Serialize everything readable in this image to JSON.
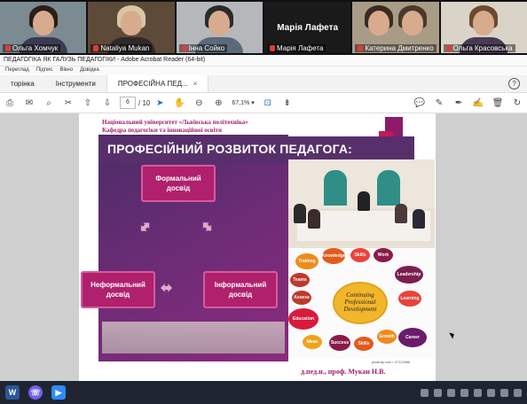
{
  "participants": [
    {
      "name": "Ольга Хомчук",
      "muted": true
    },
    {
      "name": "Nataliya Mukan",
      "muted": true
    },
    {
      "name": "Інна Сойко",
      "muted": true
    },
    {
      "name": "Марія Лафета",
      "muted": true,
      "display_text": "Марія Лафета"
    },
    {
      "name": "Катерина Дмитренко",
      "muted": true
    },
    {
      "name": "Ольга Красовська",
      "muted": true
    }
  ],
  "acrobat": {
    "window_title": "ПЕДАГОГІКА ЯК ГАЛУЗЬ ПЕДАГОГІКИ - Adobe Acrobat Reader (64-bit)",
    "menu": [
      "Переглад",
      "Підпис",
      "Вікно",
      "Довідка"
    ],
    "tabs": {
      "home": "торінка",
      "tools": "Інструменти",
      "document": "ПРОФЕСІЙНА ПЕД..."
    },
    "close_symbol": "×",
    "help_symbol": "?",
    "page_current": "6",
    "page_total": "/ 10",
    "zoom": "67,1%"
  },
  "slide": {
    "org_line1": "Національний університет «Львівська політехніка»",
    "org_line2": "Кафедра педагогіки та інноваційної освіти",
    "heading": "ПРОФЕСІЙНИЙ РОЗВИТОК ПЕДАГОГА:",
    "formal": "Формальний досвід",
    "informal_left": "Неформальний досвід",
    "informal_right": "Інформальний досвід",
    "cloud_center": "Continuing Professional Development",
    "cloud_words": [
      "Training",
      "Knowledge",
      "Skills",
      "Work",
      "Teams",
      "Leadership",
      "Assess",
      "Education",
      "Learning",
      "Success",
      "Skills",
      "Growth",
      "Career",
      "Ideas"
    ],
    "credit": "pixabay.com • 47113986",
    "author": "д.пед.н., проф. Мукан Н.В."
  }
}
